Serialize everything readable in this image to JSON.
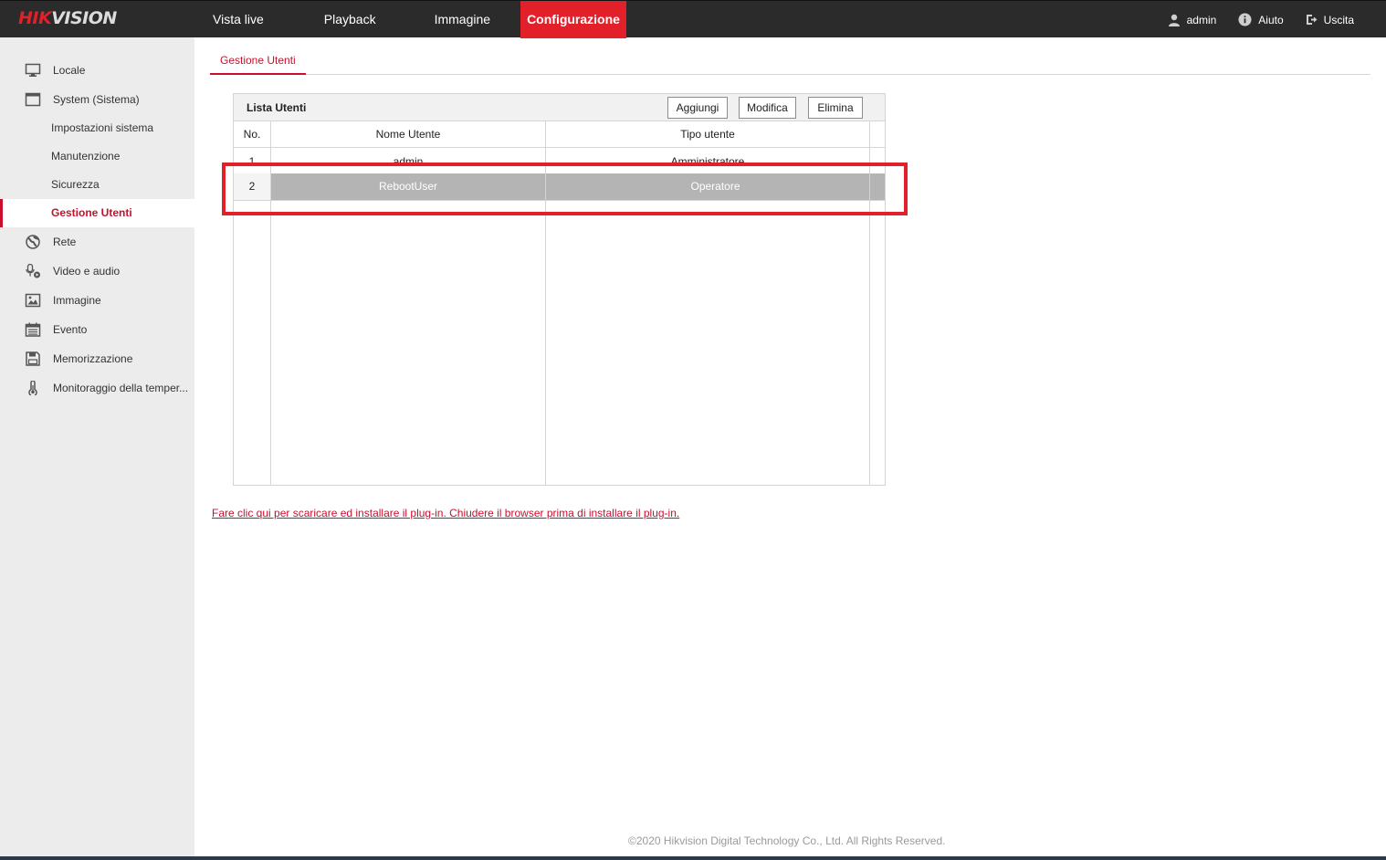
{
  "brand": {
    "part1": "HIK",
    "part2": "VISION"
  },
  "nav": {
    "items": [
      {
        "label": "Vista live"
      },
      {
        "label": "Playback"
      },
      {
        "label": "Immagine"
      },
      {
        "label": "Configurazione"
      }
    ],
    "active": "Configurazione"
  },
  "topright": {
    "user": "admin",
    "help": "Aiuto",
    "logout": "Uscita"
  },
  "sidebar": {
    "items": [
      {
        "label": "Locale",
        "icon": "monitor-icon"
      },
      {
        "label": "System (Sistema)",
        "icon": "window-icon"
      },
      {
        "label": "Rete",
        "icon": "globe-icon"
      },
      {
        "label": "Video e audio",
        "icon": "microphone-icon"
      },
      {
        "label": "Immagine",
        "icon": "image-icon"
      },
      {
        "label": "Evento",
        "icon": "calendar-icon"
      },
      {
        "label": "Memorizzazione",
        "icon": "floppy-icon"
      },
      {
        "label": "Monitoraggio della temper...",
        "icon": "thermometer-icon"
      }
    ],
    "system_sub": [
      {
        "label": "Impostazioni sistema"
      },
      {
        "label": "Manutenzione"
      },
      {
        "label": "Sicurezza"
      },
      {
        "label": "Gestione Utenti"
      }
    ],
    "active_sub": "Gestione Utenti"
  },
  "tab": {
    "label": "Gestione Utenti"
  },
  "userlist": {
    "title": "Lista Utenti",
    "buttons": {
      "add": "Aggiungi",
      "edit": "Modifica",
      "delete": "Elimina"
    },
    "columns": [
      "No.",
      "Nome Utente",
      "Tipo utente"
    ],
    "rows": [
      {
        "no": "1",
        "name": "admin",
        "type": "Amministratore"
      },
      {
        "no": "2",
        "name": "RebootUser",
        "type": "Operatore"
      }
    ],
    "selected_row": "2"
  },
  "plugin_link": "Fare clic qui per scaricare ed installare il plug-in. Chiudere il browser prima di installare il plug-in.",
  "footer": "©2020 Hikvision Digital Technology Co., Ltd. All Rights Reserved.",
  "colors": {
    "accent": "#e1202a",
    "topbar": "#2b2b2b",
    "sidebar": "#ececec",
    "selected_row": "#b4b4b4"
  }
}
